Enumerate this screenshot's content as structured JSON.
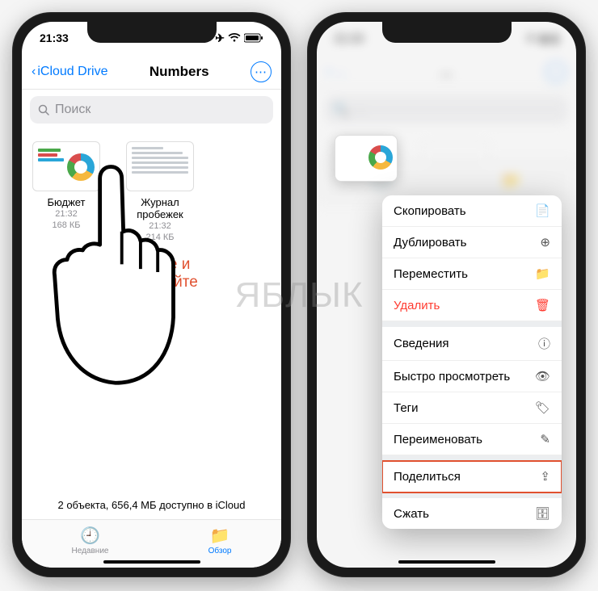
{
  "watermark": "ЯБЛЫК",
  "phone1": {
    "time": "21:33",
    "back_label": "iCloud Drive",
    "title": "Numbers",
    "search_placeholder": "Поиск",
    "files": [
      {
        "name": "Бюджет",
        "time": "21:32",
        "size": "168 КБ"
      },
      {
        "name": "Журнал пробежек",
        "time": "21:32",
        "size": "214 КБ"
      }
    ],
    "hint_line1": "Нажмите и",
    "hint_line2": "удерживайте",
    "footer": "2 объекта, 656,4 МБ доступно в iCloud",
    "tab_recent": "Недавние",
    "tab_browse": "Обзор"
  },
  "phone2": {
    "time": "21:34",
    "menu": [
      {
        "label": "Скопировать",
        "icon": "📄",
        "name": "copy"
      },
      {
        "label": "Дублировать",
        "icon": "⊕",
        "name": "duplicate"
      },
      {
        "label": "Переместить",
        "icon": "📁",
        "name": "move"
      },
      {
        "label": "Удалить",
        "icon": "🗑",
        "name": "delete",
        "destructive": true,
        "sep_after": true
      },
      {
        "label": "Сведения",
        "icon": "ⓘ",
        "name": "info"
      },
      {
        "label": "Быстро просмотреть",
        "icon": "👁",
        "name": "quicklook"
      },
      {
        "label": "Теги",
        "icon": "🏷",
        "name": "tags"
      },
      {
        "label": "Переименовать",
        "icon": "✎",
        "name": "rename",
        "sep_after": true
      },
      {
        "label": "Поделиться",
        "icon": "⇪",
        "name": "share",
        "highlight": true,
        "sep_after": true
      },
      {
        "label": "Сжать",
        "icon": "🗄",
        "name": "compress"
      }
    ]
  }
}
